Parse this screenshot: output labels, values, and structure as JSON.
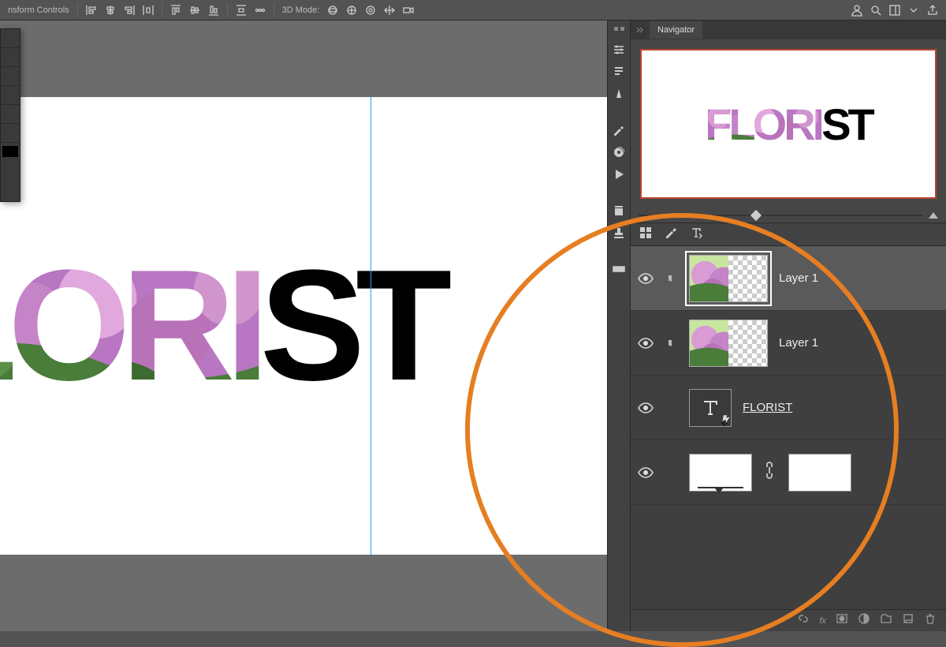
{
  "options_bar": {
    "label": "nsform Controls",
    "mode3d": "3D Mode:"
  },
  "nav": {
    "title": "Navigator"
  },
  "canvas": {
    "text": "FLORIST"
  },
  "layers": {
    "items": [
      {
        "name": "Layer 1",
        "clipped": true,
        "selected": true
      },
      {
        "name": "Layer 1",
        "clipped": true,
        "selected": false
      }
    ],
    "text_layer": "FLORIST"
  }
}
